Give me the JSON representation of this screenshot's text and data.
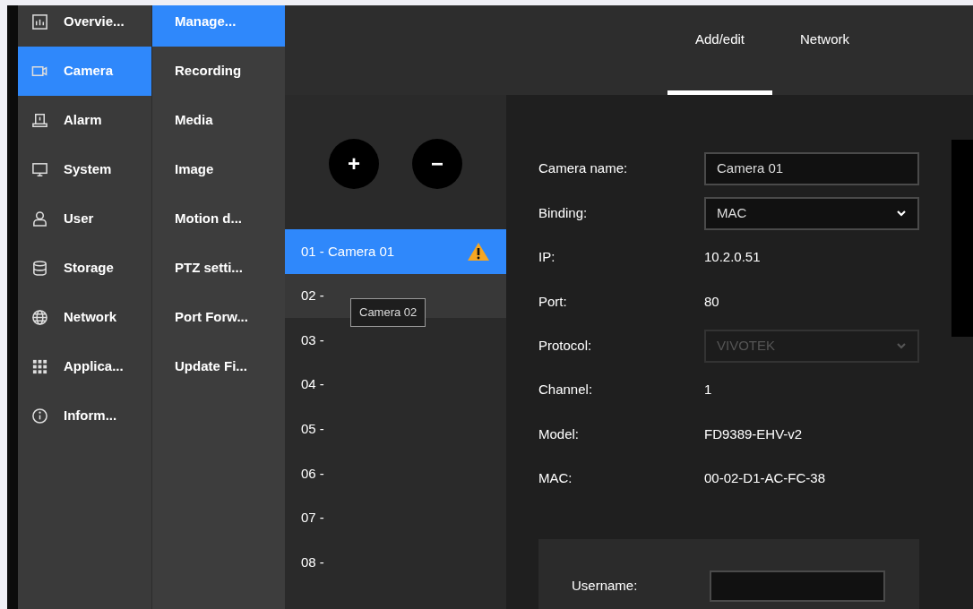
{
  "nav": [
    {
      "label": "Overvie...",
      "selected": false
    },
    {
      "label": "Camera",
      "selected": true
    },
    {
      "label": "Alarm",
      "selected": false
    },
    {
      "label": "System",
      "selected": false
    },
    {
      "label": "User",
      "selected": false
    },
    {
      "label": "Storage",
      "selected": false
    },
    {
      "label": "Network",
      "selected": false
    },
    {
      "label": "Applica...",
      "selected": false
    },
    {
      "label": "Inform...",
      "selected": false
    }
  ],
  "subnav": [
    {
      "label": "Manage...",
      "selected": true
    },
    {
      "label": "Recording",
      "selected": false
    },
    {
      "label": "Media",
      "selected": false
    },
    {
      "label": "Image",
      "selected": false
    },
    {
      "label": "Motion d...",
      "selected": false
    },
    {
      "label": "PTZ setti...",
      "selected": false
    },
    {
      "label": "Port Forw...",
      "selected": false
    },
    {
      "label": "Update Fi...",
      "selected": false
    }
  ],
  "tabs": [
    {
      "label": "Add/edit",
      "selected": true
    },
    {
      "label": "Network",
      "selected": false
    }
  ],
  "camera_list": {
    "buttons": [
      "+",
      "−"
    ],
    "items": [
      {
        "label": "01 - Camera 01",
        "selected": true,
        "hovered": false,
        "warning": true
      },
      {
        "label": "02 -",
        "selected": false,
        "hovered": true,
        "warning": false
      },
      {
        "label": "03 -",
        "selected": false,
        "hovered": false,
        "warning": false
      },
      {
        "label": "04 -",
        "selected": false,
        "hovered": false,
        "warning": false
      },
      {
        "label": "05 -",
        "selected": false,
        "hovered": false,
        "warning": false
      },
      {
        "label": "06 -",
        "selected": false,
        "hovered": false,
        "warning": false
      },
      {
        "label": "07 -",
        "selected": false,
        "hovered": false,
        "warning": false
      },
      {
        "label": "08 -",
        "selected": false,
        "hovered": false,
        "warning": false
      }
    ],
    "tooltip": "Camera 02"
  },
  "form": {
    "fields": [
      {
        "kind": "input",
        "label": "Camera name:",
        "value": "Camera 01"
      },
      {
        "kind": "select",
        "label": "Binding:",
        "value": "MAC",
        "disabled": false
      },
      {
        "kind": "text",
        "label": "IP:",
        "value": "10.2.0.51"
      },
      {
        "kind": "text",
        "label": "Port:",
        "value": "80"
      },
      {
        "kind": "select",
        "label": "Protocol:",
        "value": "VIVOTEK",
        "disabled": true
      },
      {
        "kind": "text",
        "label": "Channel:",
        "value": "1"
      },
      {
        "kind": "text",
        "label": "Model:",
        "value": "FD9389-EHV-v2"
      },
      {
        "kind": "text",
        "label": "MAC:",
        "value": "00-02-D1-AC-FC-38"
      }
    ]
  },
  "credentials": {
    "fields": [
      {
        "label": "Username:"
      }
    ]
  }
}
